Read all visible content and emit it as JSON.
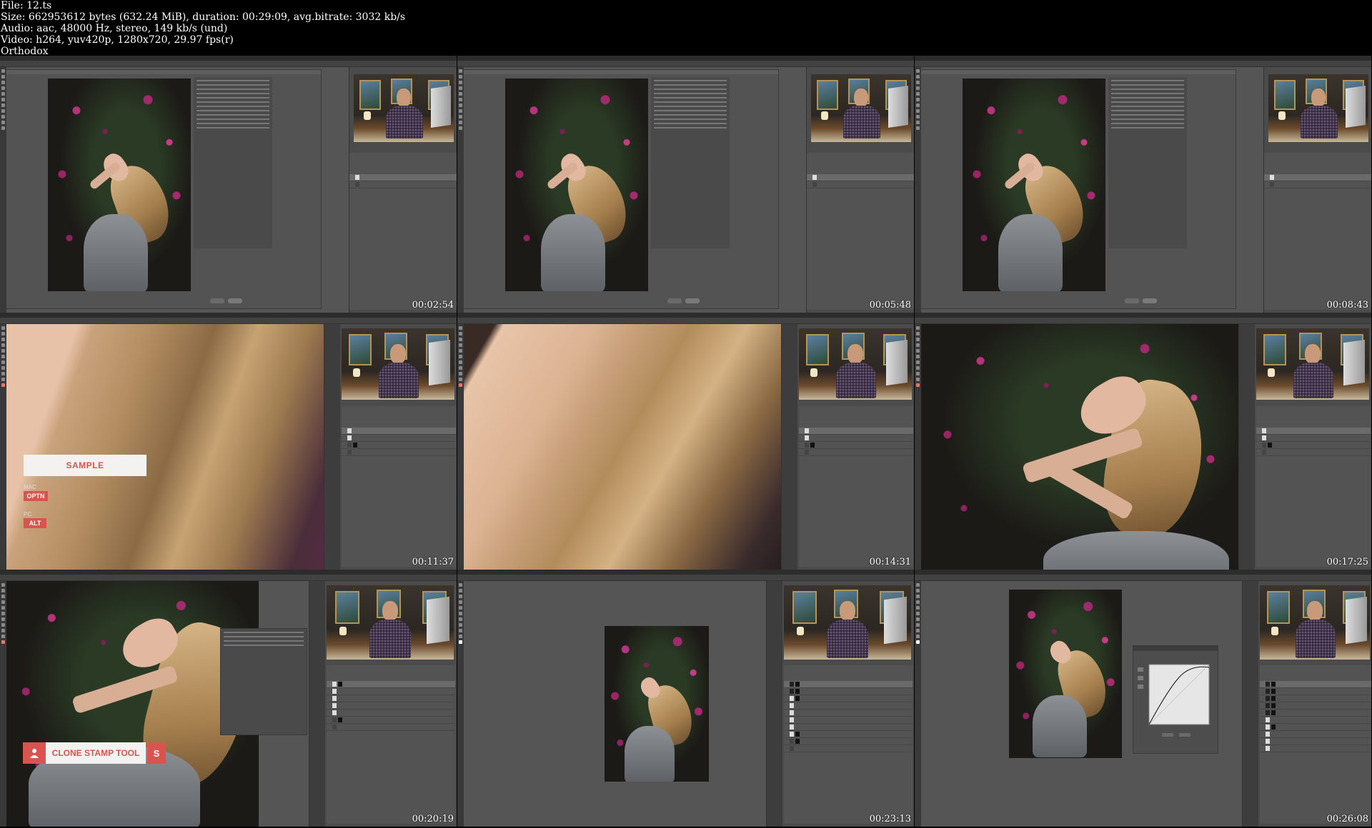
{
  "header": {
    "file": "File: 12.ts",
    "size": "Size: 662953612 bytes (632.24 MiB), duration: 00:29:09, avg.bitrate: 3032 kb/s",
    "audio": "Audio: aac, 48000 Hz, stereo, 149 kb/s (und)",
    "video": "Video: h264, yuv420p, 1280x720, 29.97 fps(r)",
    "author": "Orthodox"
  },
  "timestamps": [
    "00:02:54",
    "00:05:48",
    "00:08:43",
    "00:11:37",
    "00:14:31",
    "00:17:25",
    "00:20:19",
    "00:23:13",
    "00:26:08"
  ],
  "overlays": {
    "sample": "SAMPLE",
    "mac_label": "MAC",
    "optn_key": "OPTN",
    "pc_label": "PC",
    "alt_key": "ALT",
    "clone_stamp": "CLONE STAMP TOOL",
    "clone_key": "S"
  },
  "icons": {
    "person": "person-icon",
    "apple": "apple-icon"
  },
  "colors": {
    "accent": "#d9534f",
    "ps_dark": "#393939",
    "ps_panel": "#535353"
  }
}
